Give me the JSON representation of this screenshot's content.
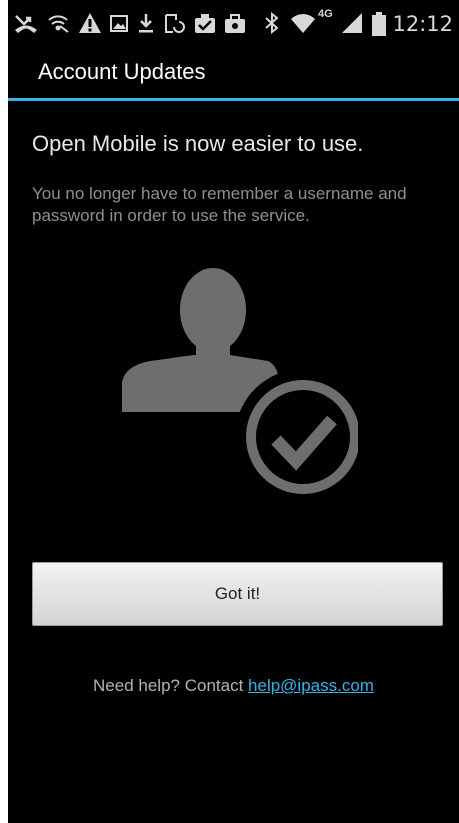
{
  "status_bar": {
    "time": "12:12",
    "network_label": "4G",
    "icons": [
      "missed-call-icon",
      "wifi-hotspot-icon",
      "warning-icon",
      "image-icon",
      "download-icon",
      "sync-icon",
      "clipboard-check-icon",
      "briefcase-icon",
      "bluetooth-icon",
      "wifi-icon",
      "signal-icon",
      "battery-icon"
    ]
  },
  "app_bar": {
    "title": "Account Updates"
  },
  "content": {
    "headline": "Open Mobile is now easier to use.",
    "body": "You no longer have to remember a username and password in order to use the service.",
    "illustration_icon": "user-checkmark-icon"
  },
  "button": {
    "label": "Got it!"
  },
  "help": {
    "prefix": "Need help? Contact ",
    "email": "help@ipass.com"
  },
  "colors": {
    "accent": "#33b5e5",
    "background": "#000000",
    "illustration": "#6e6e6e"
  }
}
